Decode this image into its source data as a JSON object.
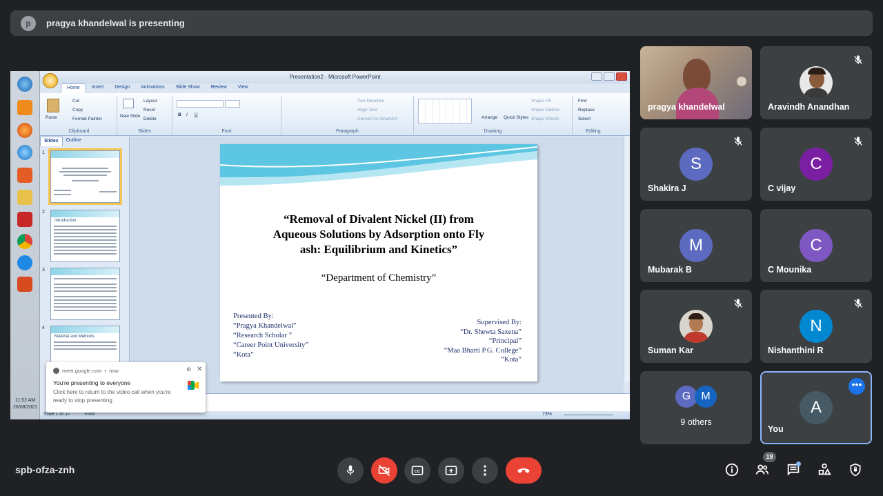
{
  "presenting_banner": {
    "avatar_letter": "p",
    "text": "pragya khandelwal is presenting"
  },
  "powerpoint": {
    "window_title": "Presentation2 - Microsoft PowerPoint",
    "tabs": [
      "Home",
      "Insert",
      "Design",
      "Animations",
      "Slide Show",
      "Review",
      "View"
    ],
    "ribbon": {
      "clipboard": {
        "label": "Clipboard",
        "paste": "Paste",
        "cut": "Cut",
        "copy": "Copy",
        "format_painter": "Format Painter"
      },
      "slides": {
        "label": "Slides",
        "new_slide": "New Slide",
        "layout": "Layout",
        "reset": "Reset",
        "delete": "Delete"
      },
      "font": {
        "label": "Font"
      },
      "paragraph": {
        "label": "Paragraph",
        "text_direction": "Text Direction",
        "align_text": "Align Text",
        "convert": "Convert to SmartArt"
      },
      "drawing": {
        "label": "Drawing",
        "arrange": "Arrange",
        "quick_styles": "Quick Styles",
        "shape_fill": "Shape Fill",
        "shape_outline": "Shape Outline",
        "shape_effects": "Shape Effects"
      },
      "editing": {
        "label": "Editing",
        "find": "Find",
        "replace": "Replace",
        "select": "Select"
      }
    },
    "panel_tabs": [
      "Slides",
      "Outline"
    ],
    "thumb_numbers": [
      "1",
      "2",
      "3",
      "4"
    ],
    "thumb2_title": "Introduction",
    "thumb4_title": "Material and Methods",
    "slide": {
      "title_line1": "“Removal of Divalent Nickel (II) from",
      "title_line2": "Aqueous Solutions by Adsorption onto Fly",
      "title_line3": "ash: Equilibrium and Kinetics”",
      "department": "“Department of Chemistry”",
      "presented_by": [
        "Presented By:",
        "“Pragya Khandelwal”",
        "“Research Scholar ”",
        "“Career Point University”",
        "“Kota”"
      ],
      "supervised_by": [
        "Supervised By:",
        "“Dr. Shewta Saxena”",
        "“Principal”",
        "“Maa Bharti P.G. College”",
        "“Kota”"
      ]
    },
    "status": {
      "slide_of": "Slide 1 of 17",
      "theme": "\"Flow\"",
      "zoom": "73%"
    },
    "clock": {
      "time": "11:52 AM",
      "date": "26/08/2021"
    }
  },
  "toast": {
    "source": "meet.google.com",
    "when": "now",
    "title": "You're presenting to everyone",
    "body": "Click here to return to the video call when you're ready to stop presenting"
  },
  "participants": [
    {
      "name": "pragya khandelwal",
      "kind": "video"
    },
    {
      "name": "Aravindh Anandhan",
      "kind": "photo",
      "muted": true
    },
    {
      "name": "Shakira J",
      "letter": "S",
      "color": "#5c6bc0",
      "muted": true
    },
    {
      "name": "C vijay",
      "letter": "C",
      "color": "#7b1fa2",
      "muted": true
    },
    {
      "name": "Mubarak B",
      "letter": "M",
      "color": "#5c6bc0"
    },
    {
      "name": "C Mounika",
      "letter": "C",
      "color": "#7e57c2"
    },
    {
      "name": "Suman Kar",
      "kind": "photo",
      "muted": true
    },
    {
      "name": "Nishanthini R",
      "letter": "N",
      "color": "#0288d1",
      "muted": true
    },
    {
      "name": "9 others",
      "letters": [
        "G",
        "M"
      ],
      "colors": [
        "#5c6bc0",
        "#1565c0"
      ]
    },
    {
      "name": "You",
      "letter": "A",
      "color": "#455a64"
    }
  ],
  "meeting_code": "spb-ofza-znh",
  "people_count": "19"
}
